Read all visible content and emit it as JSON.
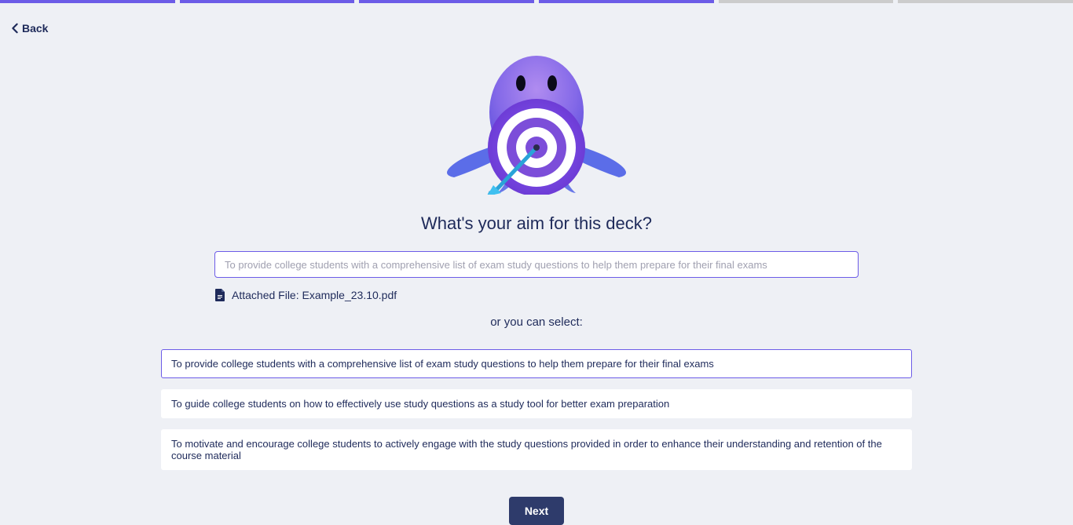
{
  "progress": {
    "total": 6,
    "active": 4
  },
  "back": {
    "label": "Back"
  },
  "heading": "What's your aim for this deck?",
  "input": {
    "placeholder": "To provide college students with a comprehensive list of exam study questions to help them prepare for their final exams"
  },
  "attached": {
    "label": "Attached File: Example_23.10.pdf"
  },
  "select_label": "or you can select:",
  "options": [
    {
      "text": "To provide college students with a comprehensive list of exam study questions to help them prepare for their final exams",
      "selected": true
    },
    {
      "text": "To guide college students on how to effectively use study questions as a study tool for better exam preparation",
      "selected": false
    },
    {
      "text": "To motivate and encourage college students to actively engage with the study questions provided in order to enhance their understanding and retention of the course material",
      "selected": false
    }
  ],
  "next": {
    "label": "Next"
  }
}
